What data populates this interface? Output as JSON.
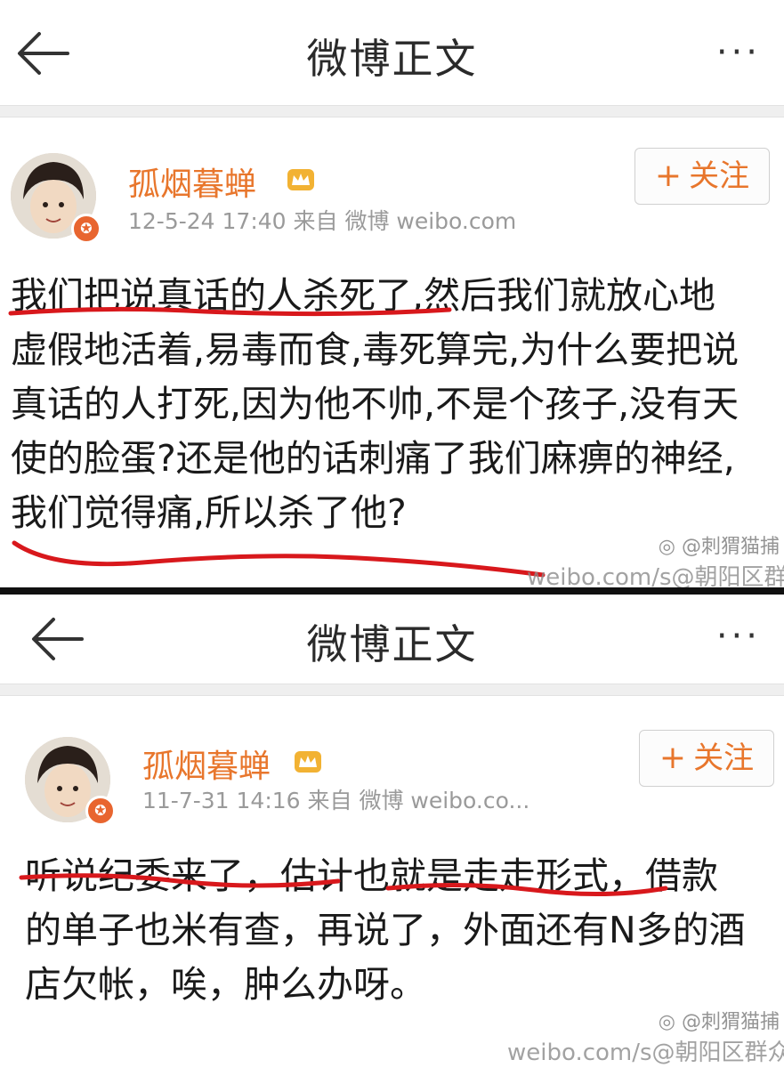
{
  "post1": {
    "nav_title": "微博正文",
    "more_label": "···",
    "username": "孤烟暮蝉",
    "meta": "12-5-24 17:40 来自 微博 weibo.com",
    "follow_label": "关注",
    "body": "我们把说真话的人杀死了,然后我们就放心地\n虚假地活着,易毒而食,毒死算完,为什么要把说\n真话的人打死,因为他不帅,不是个孩子,没有天\n使的脸蛋?还是他的话刺痛了我们麻痹的神经,\n我们觉得痛,所以杀了他?",
    "watermark_line1": "@刺猬猫捕",
    "watermark_line2": "weibo.com/s@朝阳区群众"
  },
  "post2": {
    "nav_title": "微博正文",
    "more_label": "···",
    "username": "孤烟暮蝉",
    "meta": "11-7-31 14:16 来自 微博 weibo.co...",
    "follow_label": "关注",
    "body": "听说纪委来了，估计也就是走走形式，借款\n的单子也米有查，再说了，外面还有N多的酒\n店欠帐，唉，肿么办呀。",
    "watermark_line1": "@刺猬猫捕",
    "watermark_line2": "weibo.com/s@朝阳区群众"
  },
  "colors": {
    "username": "#e8762c",
    "underline": "#d8181c",
    "badge": "#e8652f"
  },
  "icons": [
    "back-arrow-icon",
    "more-icon",
    "verified-badge-icon",
    "crown-icon",
    "plus-icon",
    "weibo-logo-icon"
  ]
}
